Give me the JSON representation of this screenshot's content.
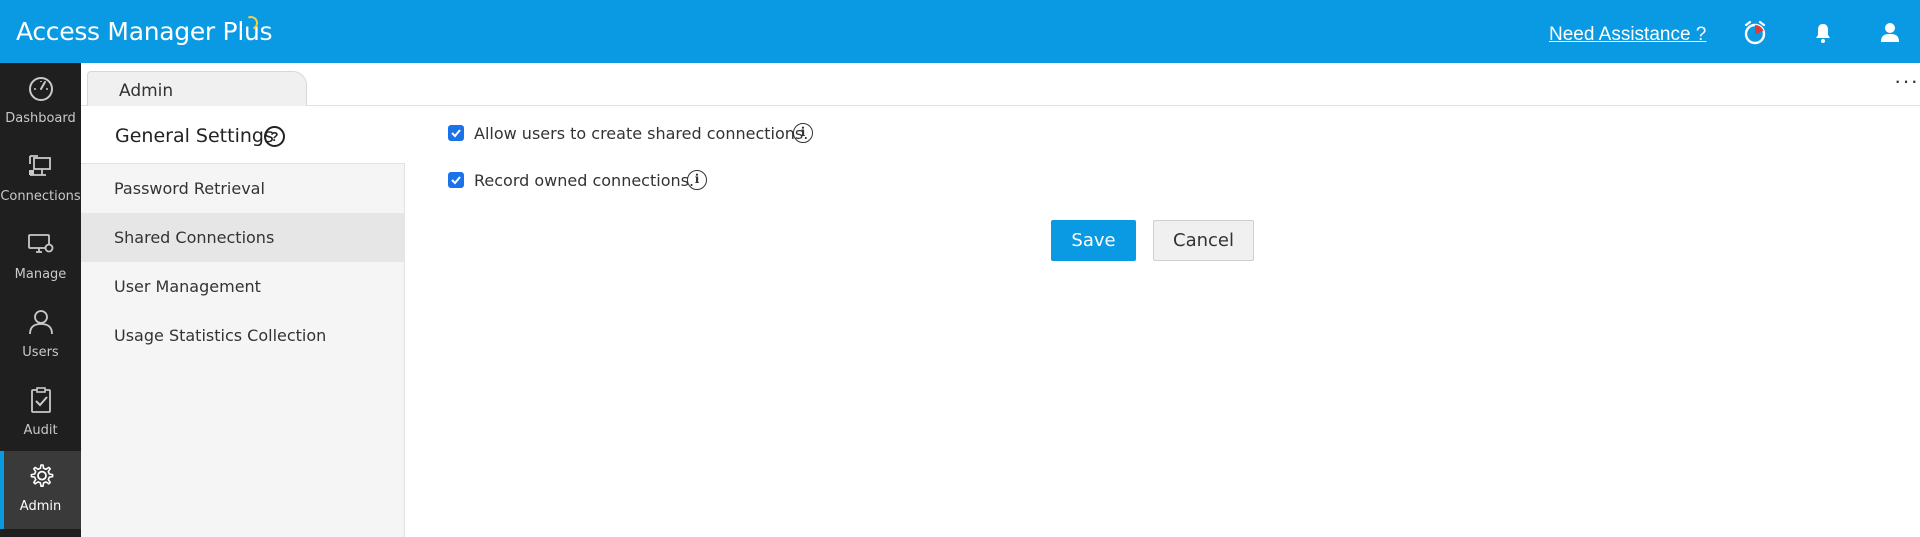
{
  "app": {
    "title": "Access Manager Plus"
  },
  "header": {
    "assistance_link": "Need Assistance ?",
    "icons": [
      "alarm-clock-icon",
      "bell-icon",
      "user-icon"
    ]
  },
  "nav": {
    "items": [
      {
        "label": "Dashboard",
        "icon": "dashboard-gauge-icon"
      },
      {
        "label": "Connections",
        "icon": "connections-icon"
      },
      {
        "label": "Manage",
        "icon": "manage-monitor-gear-icon"
      },
      {
        "label": "Users",
        "icon": "user-icon"
      },
      {
        "label": "Audit",
        "icon": "clipboard-check-icon"
      },
      {
        "label": "Admin",
        "icon": "gear-icon"
      }
    ],
    "active": "Admin"
  },
  "tabs": [
    {
      "label": "Admin"
    }
  ],
  "settings_panel": {
    "title": "General Settings",
    "items": [
      {
        "label": "Password Retrieval"
      },
      {
        "label": "Shared Connections"
      },
      {
        "label": "User Management"
      },
      {
        "label": "Usage Statistics Collection"
      }
    ],
    "active": "Shared Connections"
  },
  "main": {
    "options": [
      {
        "label": "Allow users to create shared connections.",
        "checked": true
      },
      {
        "label": "Record owned connections.",
        "checked": true
      }
    ],
    "save_label": "Save",
    "cancel_label": "Cancel"
  },
  "colors": {
    "accent": "#0a9ae3",
    "rail_bg": "#1f1f1f",
    "checkbox": "#1a73e8"
  }
}
